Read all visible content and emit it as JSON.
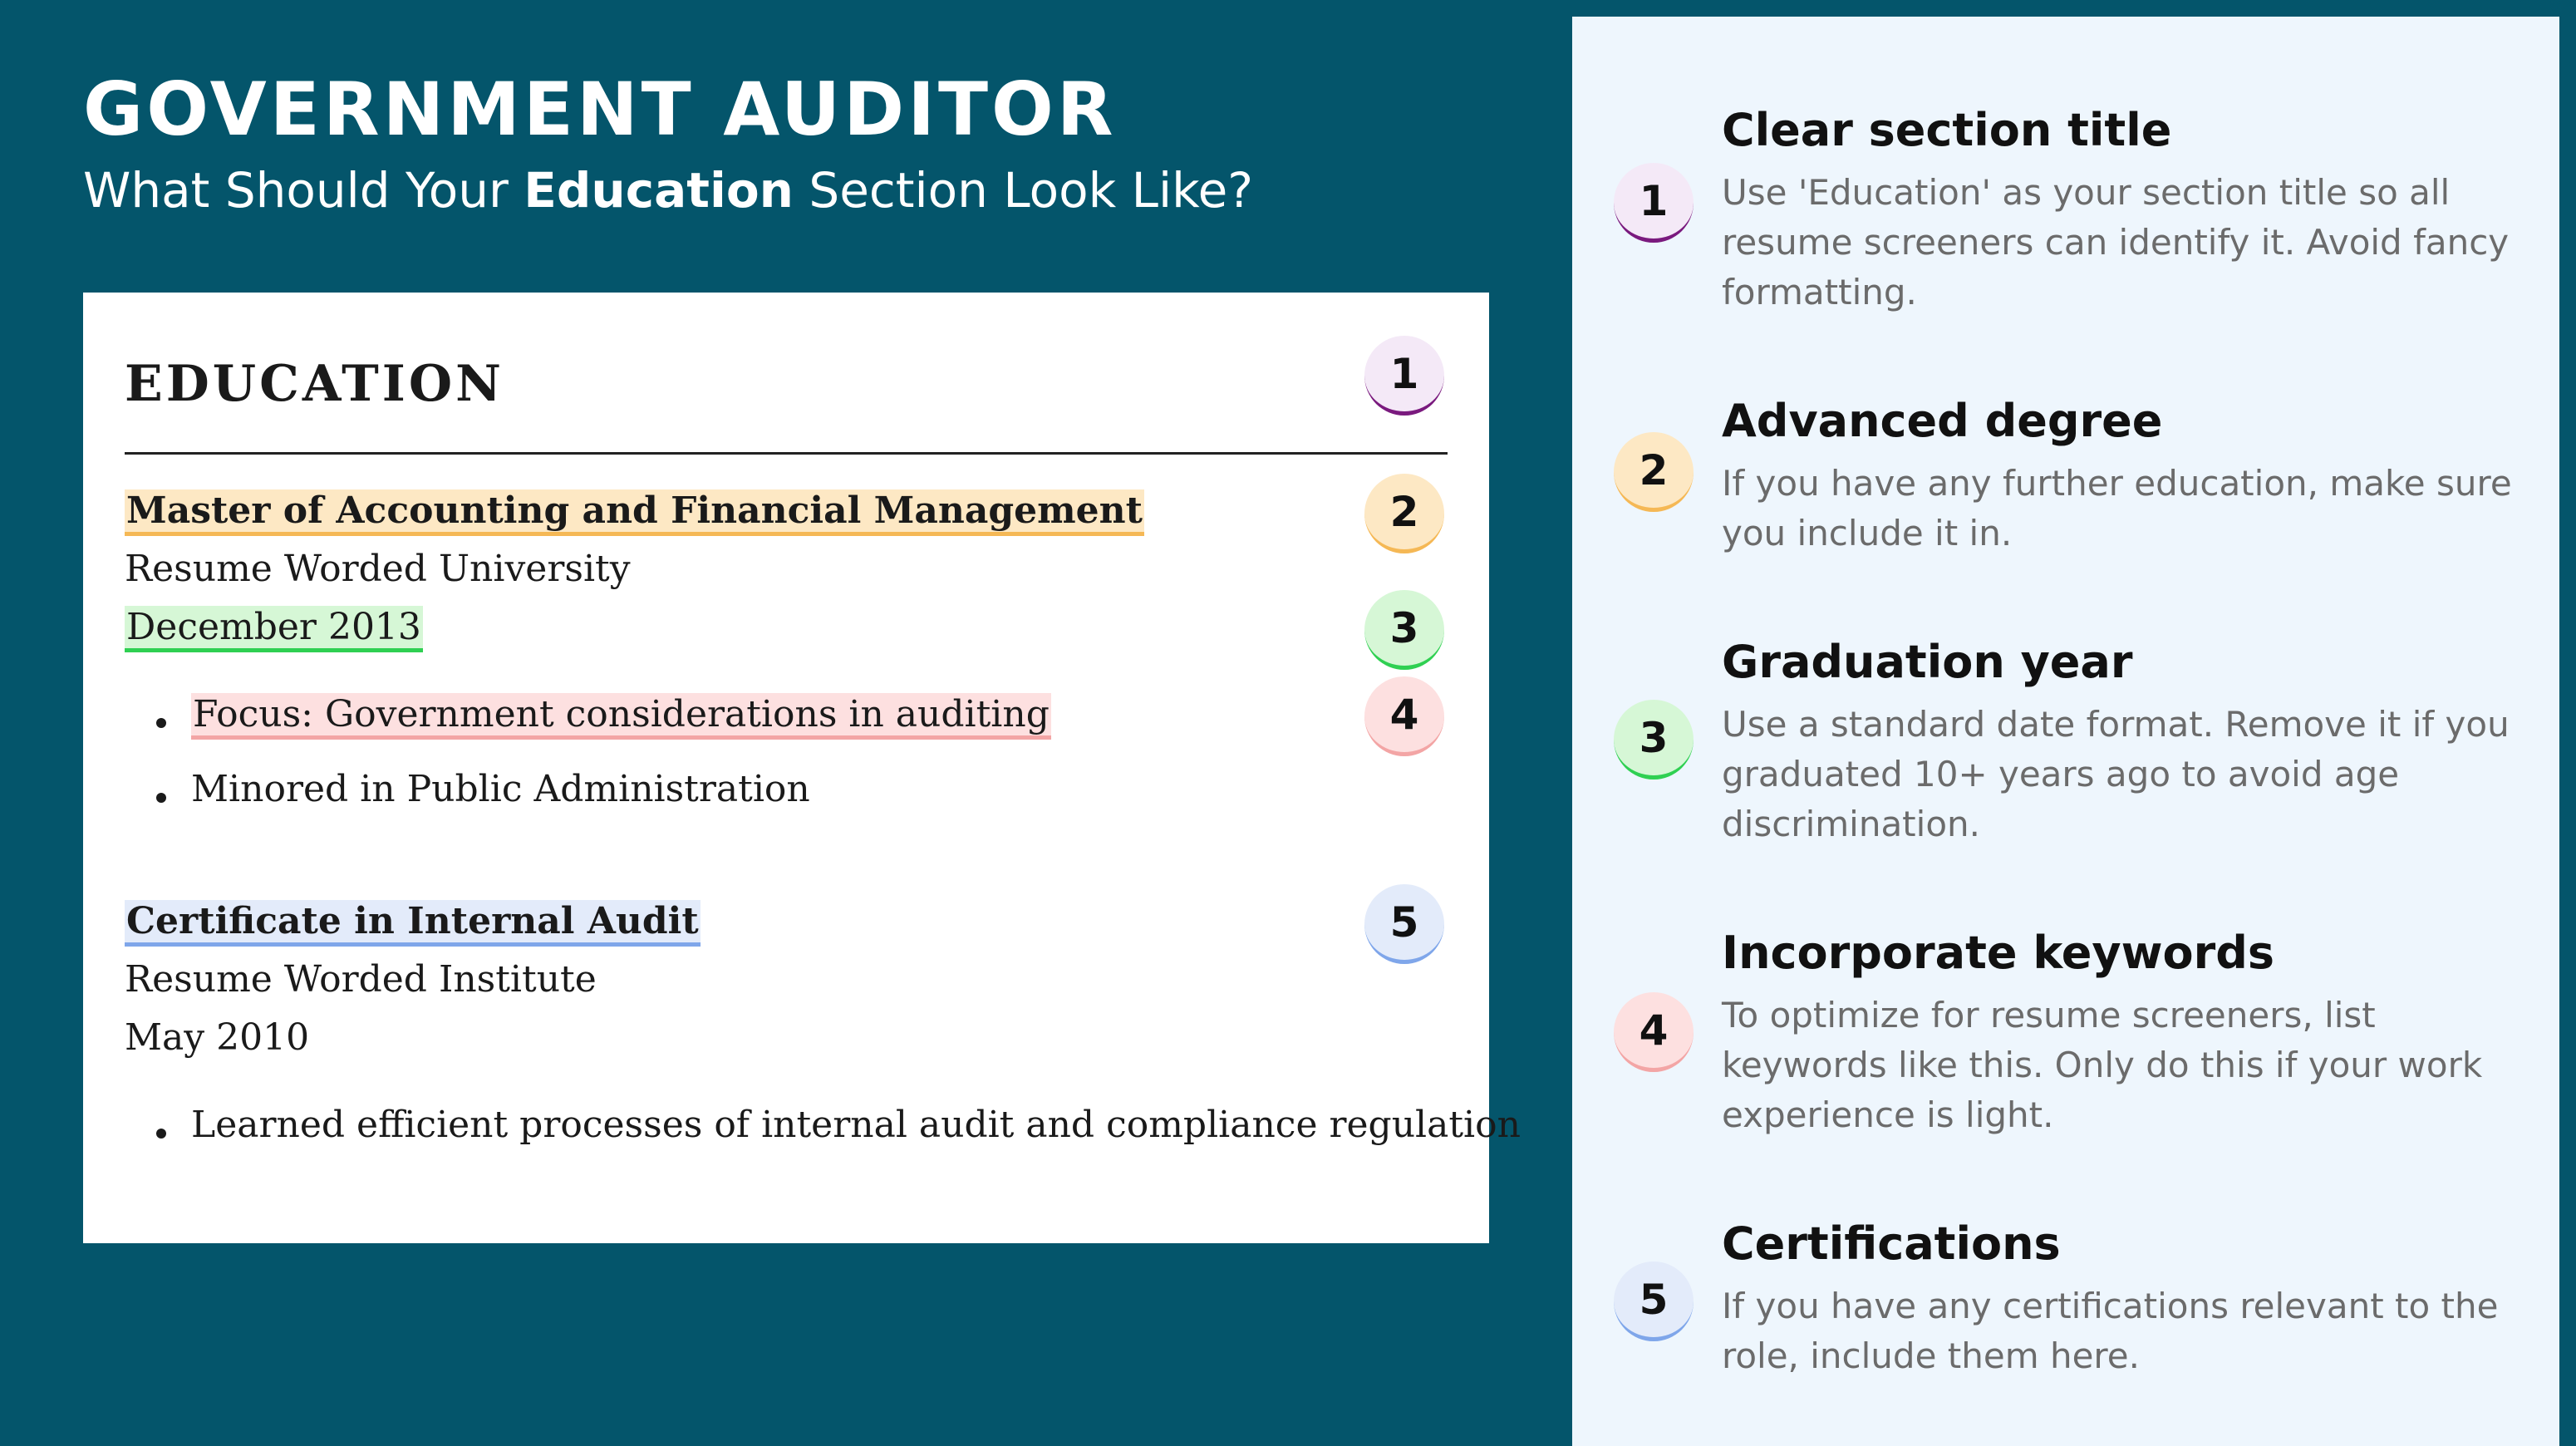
{
  "header": {
    "title": "GOVERNMENT AUDITOR",
    "subtitle_pre": "What Should Your ",
    "subtitle_bold": "Education",
    "subtitle_post": " Section Look Like?"
  },
  "resume": {
    "section_title": "EDUCATION",
    "entries": [
      {
        "degree": "Master of Accounting and Financial Management",
        "school": "Resume Worded University",
        "date": "December 2013",
        "bullets": [
          "Focus: Government considerations in auditing",
          "Minored in Public Administration"
        ]
      },
      {
        "degree": "Certificate in Internal Audit",
        "school": "Resume Worded Institute",
        "date": "May 2010",
        "bullets": [
          "Learned efficient processes of internal audit and compliance regulation"
        ]
      }
    ],
    "badges": [
      "1",
      "2",
      "3",
      "4",
      "5"
    ]
  },
  "tips": [
    {
      "number": "1",
      "title": "Clear section title",
      "body": "Use 'Education' as your section title so all resume screeners can identify it. Avoid fancy formatting."
    },
    {
      "number": "2",
      "title": "Advanced degree",
      "body": "If you have any further education, make sure you include it in."
    },
    {
      "number": "3",
      "title": "Graduation year",
      "body": "Use a standard date format. Remove it if you graduated 10+ years ago to avoid age discrimination."
    },
    {
      "number": "4",
      "title": "Incorporate keywords",
      "body": "To optimize for resume screeners, list keywords like this. Only do this if your work experience is light."
    },
    {
      "number": "5",
      "title": "Certifications",
      "body": "If you have any certifications relevant to the role, include them here."
    }
  ],
  "colors": {
    "background": "#04556b",
    "panel": "#eef6fd",
    "badge_1": "#7a1a7e",
    "badge_2": "#f5b855",
    "badge_3": "#2fd052",
    "badge_4": "#f3a5a5",
    "badge_5": "#7fa6ea"
  }
}
